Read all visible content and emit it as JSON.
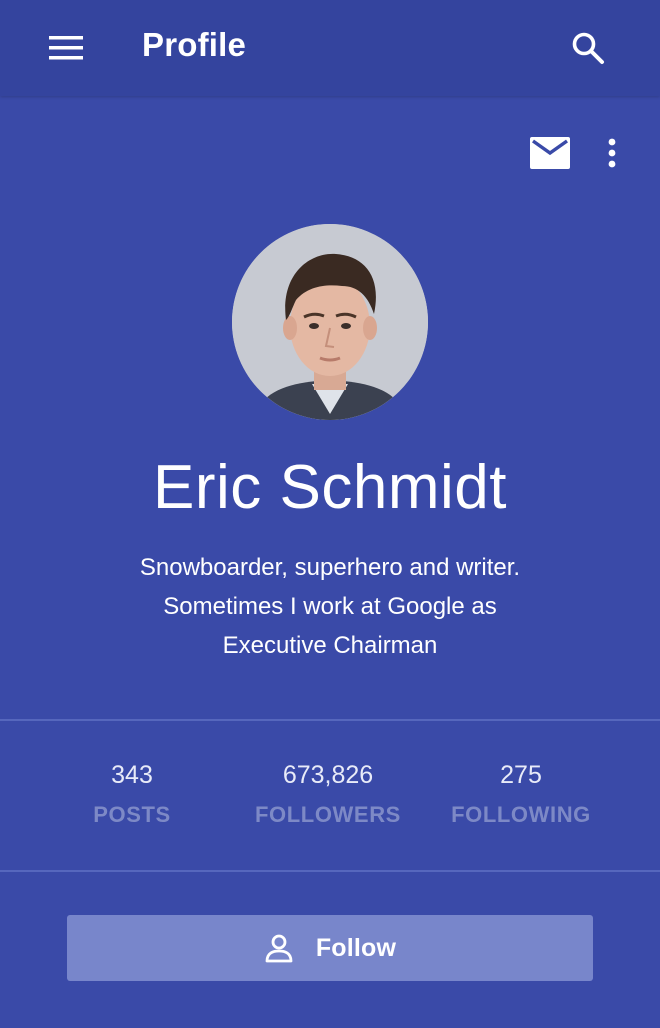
{
  "appbar": {
    "title": "Profile",
    "menu_icon": "hamburger-menu-icon",
    "search_icon": "search-icon"
  },
  "actions": {
    "mail_icon": "mail-icon",
    "more_icon": "more-vert-icon"
  },
  "profile": {
    "name": "Eric Schmidt",
    "bio_lines": [
      "Snowboarder, superhero and writer.",
      "Sometimes I work at Google as",
      "Executive Chairman"
    ]
  },
  "stats": [
    {
      "value": "343",
      "label": "POSTS"
    },
    {
      "value": "673,826",
      "label": "FOLLOWERS"
    },
    {
      "value": "275",
      "label": "FOLLOWING"
    }
  ],
  "follow_button": {
    "label": "Follow",
    "icon": "person-outline-icon"
  },
  "colors": {
    "background": "#3a4aa8",
    "appbar": "#34449e",
    "button": "#7886cb",
    "stat_label": "#7d89c6"
  }
}
